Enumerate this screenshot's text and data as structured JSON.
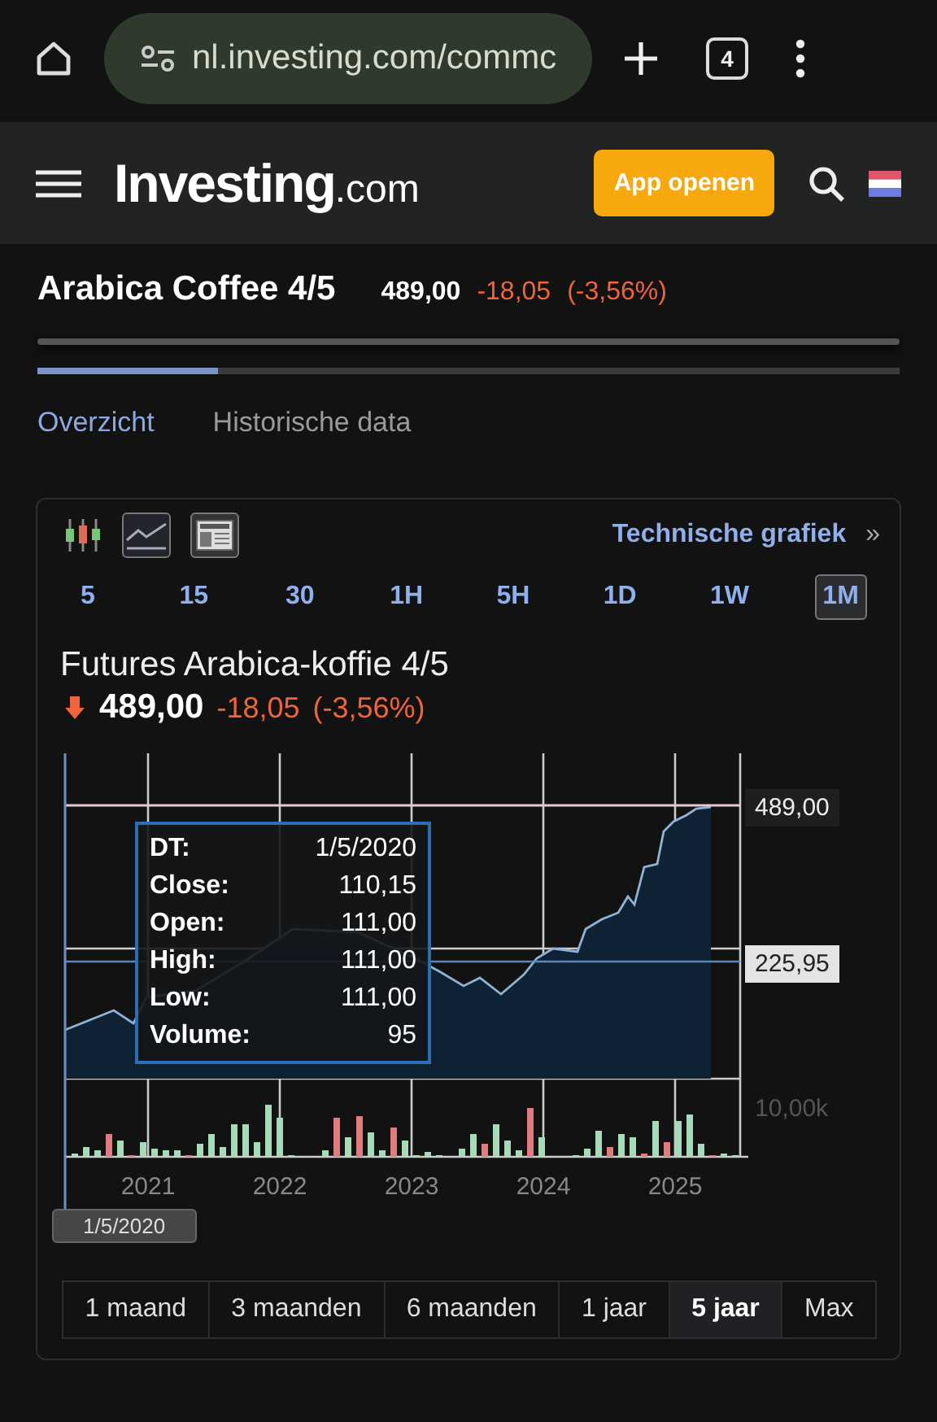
{
  "browser": {
    "url": "nl.investing.com/commc",
    "tab_count": "4"
  },
  "header": {
    "logo": "**Investing**.com",
    "app_button": "App openen"
  },
  "quote": {
    "name": "Arabica Coffee 4/5",
    "price": "489,00",
    "change": "-18,05",
    "change_pct": "(-3,56%)"
  },
  "loading_bar": {
    "level": 0.21
  },
  "tabs": [
    {
      "label": "Overzicht",
      "selected": true
    },
    {
      "label": "Historische data",
      "selected": false
    }
  ],
  "chart_card": {
    "link": "Technische grafiek",
    "link_arrow": "»",
    "intervals": [
      {
        "label": "5",
        "selected": false
      },
      {
        "label": "15",
        "selected": false
      },
      {
        "label": "30",
        "selected": false
      },
      {
        "label": "1H",
        "selected": false
      },
      {
        "label": "5H",
        "selected": false
      },
      {
        "label": "1D",
        "selected": false
      },
      {
        "label": "1W",
        "selected": false
      },
      {
        "label": "1M",
        "selected": true
      }
    ],
    "title": "Futures Arabica-koffie 4/5",
    "price": "489,00",
    "change": "-18,05",
    "change_pct": "(-3,56%)",
    "chart": {
      "price_labels": [
        {
          "kind": "last",
          "text": "489,00"
        },
        {
          "kind": "cursor",
          "text": "225,95"
        }
      ],
      "volume_label": "10,00k",
      "x_labels": [
        "2021",
        "2022",
        "2023",
        "2024",
        "2025"
      ],
      "tooltip": [
        {
          "label": "DT:",
          "value": "1/5/2020"
        },
        {
          "label": "Close:",
          "value": "110,15"
        },
        {
          "label": "Open:",
          "value": "111,00"
        },
        {
          "label": "High:",
          "value": "111,00"
        },
        {
          "label": "Low:",
          "value": "111,00"
        },
        {
          "label": "Volume:",
          "value": "95"
        }
      ],
      "cursor_date": "1/5/2020"
    },
    "ranges": [
      {
        "label": "1 maand",
        "selected": false
      },
      {
        "label": "3 maanden",
        "selected": false
      },
      {
        "label": "6 maanden",
        "selected": false
      },
      {
        "label": "1 jaar",
        "selected": false
      },
      {
        "label": "5 jaar",
        "selected": true
      },
      {
        "label": "Max",
        "selected": false
      }
    ]
  }
}
